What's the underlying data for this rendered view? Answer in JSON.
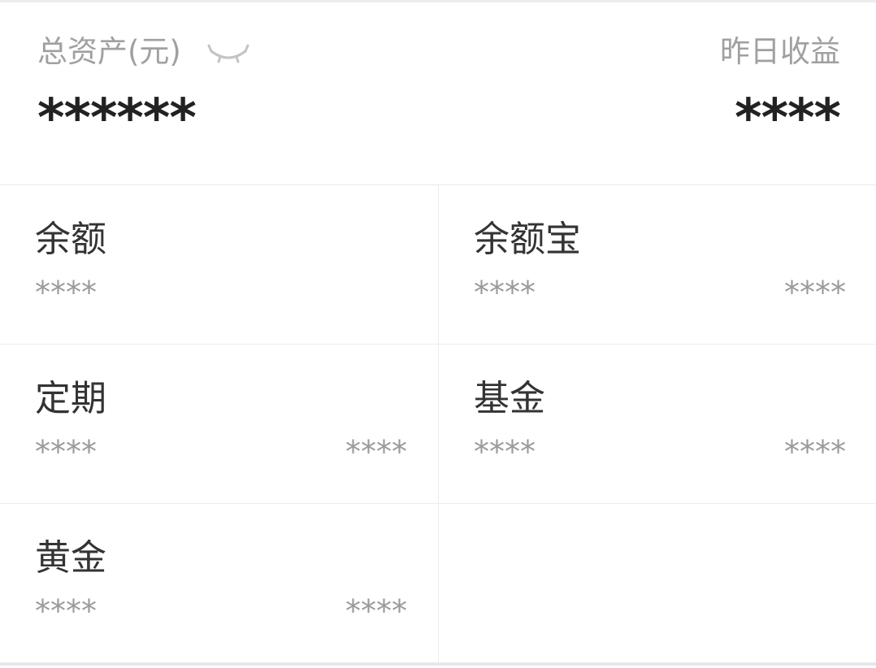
{
  "summary": {
    "total_label": "总资产(元)",
    "total_value": "******",
    "yesterday_label": "昨日收益",
    "yesterday_value": "****",
    "eye_icon": "eye-closed-icon"
  },
  "assets": [
    {
      "title": "余额",
      "amount": "****",
      "income": ""
    },
    {
      "title": "余额宝",
      "amount": "****",
      "income": "****"
    },
    {
      "title": "定期",
      "amount": "****",
      "income": "****"
    },
    {
      "title": "基金",
      "amount": "****",
      "income": "****"
    },
    {
      "title": "黄金",
      "amount": "****",
      "income": "****"
    }
  ],
  "colors": {
    "primary_text": "#333333",
    "secondary_text": "#a0a0a0",
    "divider": "#ececec"
  }
}
